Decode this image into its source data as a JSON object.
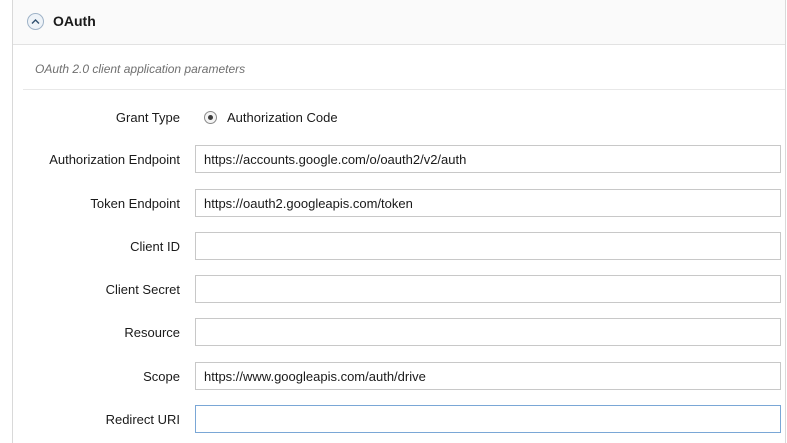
{
  "section": {
    "title": "OAuth",
    "description": "OAuth 2.0 client application parameters"
  },
  "form": {
    "grant_type": {
      "label": "Grant Type",
      "option_label": "Authorization Code",
      "selected": true
    },
    "authorization_endpoint": {
      "label": "Authorization Endpoint",
      "value": "https://accounts.google.com/o/oauth2/v2/auth"
    },
    "token_endpoint": {
      "label": "Token Endpoint",
      "value": "https://oauth2.googleapis.com/token"
    },
    "client_id": {
      "label": "Client ID",
      "value": ""
    },
    "client_secret": {
      "label": "Client Secret",
      "value": ""
    },
    "resource": {
      "label": "Resource",
      "value": ""
    },
    "scope": {
      "label": "Scope",
      "value": "https://www.googleapis.com/auth/drive"
    },
    "redirect_uri": {
      "label": "Redirect URI",
      "value": ""
    }
  },
  "colors": {
    "focus_border": "#7aa7d6",
    "collapse_button": "#eef3f8"
  },
  "icons": {
    "collapse": "chevron-up-icon"
  }
}
